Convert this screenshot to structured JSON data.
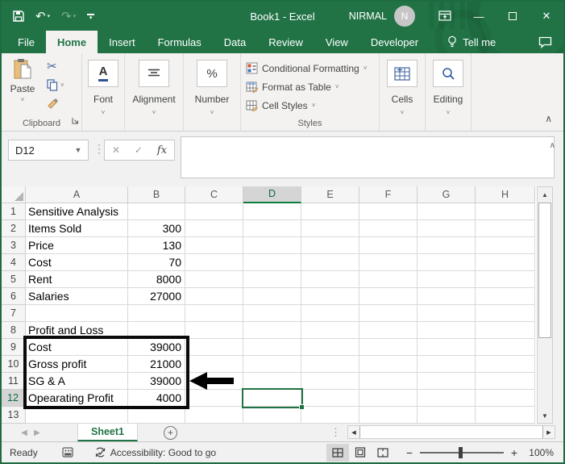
{
  "window": {
    "title": "Book1  -  Excel",
    "user_name": "NIRMAL",
    "avatar_initial": "N"
  },
  "tabs": [
    {
      "label": "File",
      "active": false
    },
    {
      "label": "Home",
      "active": true
    },
    {
      "label": "Insert",
      "active": false
    },
    {
      "label": "Formulas",
      "active": false
    },
    {
      "label": "Data",
      "active": false
    },
    {
      "label": "Review",
      "active": false
    },
    {
      "label": "View",
      "active": false
    },
    {
      "label": "Developer",
      "active": false
    }
  ],
  "tell_me": "Tell me",
  "ribbon": {
    "clipboard": {
      "paste_label": "Paste",
      "group_label": "Clipboard"
    },
    "font_label": "Font",
    "alignment_label": "Alignment",
    "number_label": "Number",
    "styles": {
      "items": [
        "Conditional Formatting",
        "Format as Table",
        "Cell Styles"
      ],
      "group_label": "Styles"
    },
    "cells_label": "Cells",
    "editing_label": "Editing"
  },
  "formula_bar": {
    "name_box": "D12",
    "fx_label": "fx",
    "content": ""
  },
  "grid": {
    "columns": [
      "A",
      "B",
      "C",
      "D",
      "E",
      "F",
      "G",
      "H"
    ],
    "selected_column": "D",
    "selected_row": 12,
    "active_cell": "D12",
    "rows": [
      {
        "n": 1,
        "A": "Sensitive Analysis"
      },
      {
        "n": 2,
        "A": "Items Sold",
        "B": "300"
      },
      {
        "n": 3,
        "A": "Price",
        "B": "130"
      },
      {
        "n": 4,
        "A": "Cost",
        "B": "70"
      },
      {
        "n": 5,
        "A": "Rent",
        "B": "8000"
      },
      {
        "n": 6,
        "A": "Salaries",
        "B": "27000"
      },
      {
        "n": 7
      },
      {
        "n": 8,
        "A": "Profit and Loss"
      },
      {
        "n": 9,
        "A": "Cost",
        "B": "39000"
      },
      {
        "n": 10,
        "A": "Gross profit",
        "B": "21000"
      },
      {
        "n": 11,
        "A": "SG & A",
        "B": "39000"
      },
      {
        "n": 12,
        "A": "Opearating Profit",
        "B": "4000"
      },
      {
        "n": 13
      }
    ]
  },
  "sheet_bar": {
    "sheet_tab": "Sheet1"
  },
  "status_bar": {
    "ready": "Ready",
    "accessibility": "Accessibility: Good to go",
    "zoom": "100%"
  },
  "colors": {
    "excel_green": "#217346",
    "accent_green": "#107c41",
    "annotation": "#000000"
  }
}
